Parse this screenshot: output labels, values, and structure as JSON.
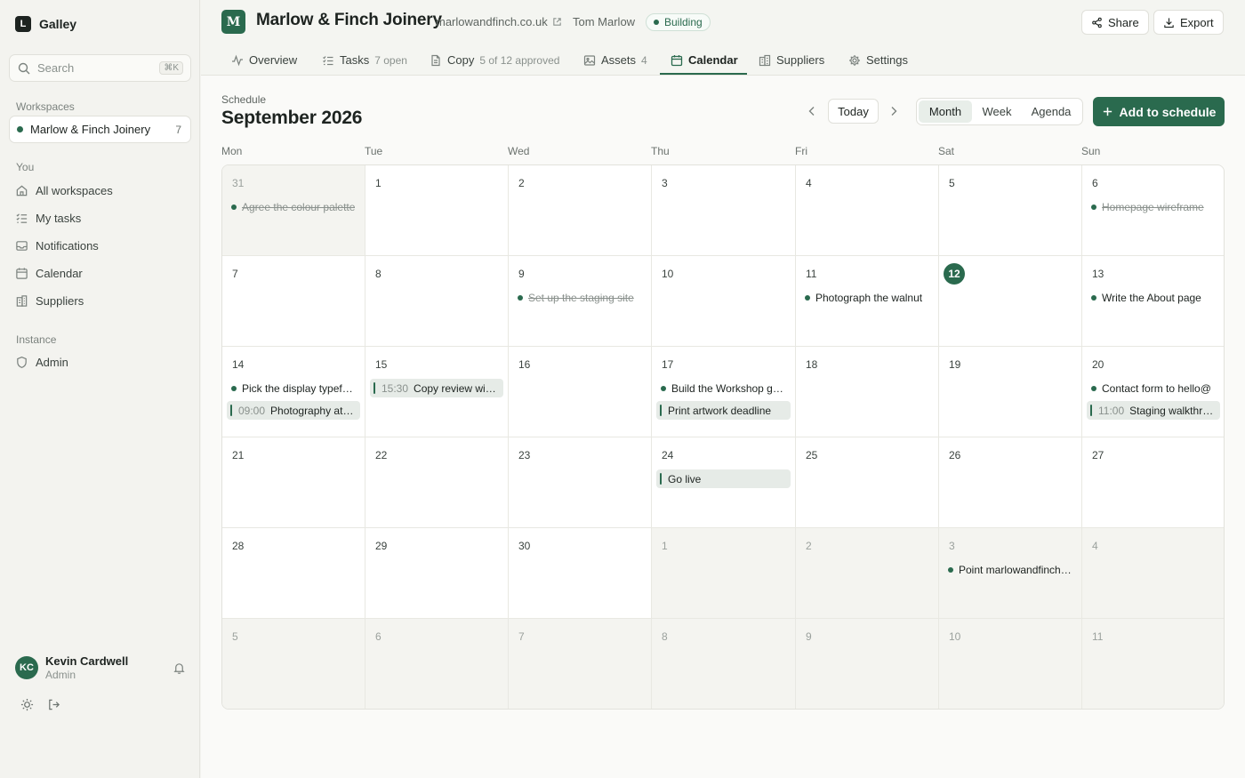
{
  "app": {
    "name": "Galley",
    "logo_letter": "L"
  },
  "sidebar": {
    "search_placeholder": "Search",
    "search_shortcut": "⌘K",
    "workspaces_label": "Workspaces",
    "workspace": {
      "name": "Marlow & Finch Joinery",
      "count": "7"
    },
    "you_label": "You",
    "you_items": [
      "All workspaces",
      "My tasks",
      "Notifications",
      "Calendar",
      "Suppliers"
    ],
    "instance_label": "Instance",
    "instance_items": [
      "Admin"
    ],
    "user": {
      "initials": "KC",
      "name": "Kevin Cardwell",
      "role": "Admin"
    }
  },
  "header": {
    "logo_letter": "M",
    "title": "Marlow & Finch Joinery",
    "url": "marlowandfinch.co.uk",
    "owner": "Tom Marlow",
    "status": "Building",
    "share_label": "Share",
    "export_label": "Export",
    "tabs": [
      {
        "label": "Overview",
        "meta": ""
      },
      {
        "label": "Tasks",
        "meta": "7 open"
      },
      {
        "label": "Copy",
        "meta": "5 of 12 approved"
      },
      {
        "label": "Assets",
        "meta": "4"
      },
      {
        "label": "Calendar",
        "meta": ""
      },
      {
        "label": "Suppliers",
        "meta": ""
      },
      {
        "label": "Settings",
        "meta": ""
      }
    ],
    "active_tab": "Calendar"
  },
  "toolbar": {
    "breadcrumb": "Schedule",
    "title": "September 2026",
    "today_label": "Today",
    "views": [
      "Month",
      "Week",
      "Agenda"
    ],
    "active_view": "Month",
    "add_label": "Add to schedule"
  },
  "colors": {
    "accent": "#2a6a4e",
    "accent_soft": "#e6ebe7",
    "out_of_month": "#f4f4f0"
  },
  "calendar": {
    "weekdays": [
      "Mon",
      "Tue",
      "Wed",
      "Thu",
      "Fri",
      "Sat",
      "Sun"
    ],
    "today": "12",
    "weeks": [
      [
        {
          "day": "31",
          "out": true,
          "events": [
            {
              "kind": "task",
              "done": true,
              "text": "Agree the colour palette"
            }
          ]
        },
        {
          "day": "1",
          "events": []
        },
        {
          "day": "2",
          "events": []
        },
        {
          "day": "3",
          "events": []
        },
        {
          "day": "4",
          "events": []
        },
        {
          "day": "5",
          "events": []
        },
        {
          "day": "6",
          "events": [
            {
              "kind": "task",
              "done": true,
              "text": "Homepage wireframe"
            }
          ]
        }
      ],
      [
        {
          "day": "7",
          "events": []
        },
        {
          "day": "8",
          "events": []
        },
        {
          "day": "9",
          "events": [
            {
              "kind": "task",
              "done": true,
              "text": "Set up the staging site"
            }
          ]
        },
        {
          "day": "10",
          "events": []
        },
        {
          "day": "11",
          "events": [
            {
              "kind": "task",
              "done": false,
              "text": "Photograph the walnut"
            }
          ]
        },
        {
          "day": "12",
          "today": true,
          "events": []
        },
        {
          "day": "13",
          "events": [
            {
              "kind": "task",
              "done": false,
              "text": "Write the About page"
            }
          ]
        }
      ],
      [
        {
          "day": "14",
          "events": [
            {
              "kind": "task",
              "done": false,
              "text": "Pick the display typeface"
            },
            {
              "kind": "event",
              "time": "09:00",
              "text": "Photography at the workshop"
            }
          ]
        },
        {
          "day": "15",
          "events": [
            {
              "kind": "event",
              "time": "15:30",
              "text": "Copy review with Tom"
            }
          ]
        },
        {
          "day": "16",
          "events": []
        },
        {
          "day": "17",
          "events": [
            {
              "kind": "task",
              "done": false,
              "text": "Build the Workshop gallery"
            },
            {
              "kind": "event",
              "time": "",
              "text": "Print artwork deadline"
            }
          ]
        },
        {
          "day": "18",
          "events": []
        },
        {
          "day": "19",
          "events": []
        },
        {
          "day": "20",
          "events": [
            {
              "kind": "task",
              "done": false,
              "text": "Contact form to hello@"
            },
            {
              "kind": "event",
              "time": "11:00",
              "text": "Staging walkthrough"
            }
          ]
        }
      ],
      [
        {
          "day": "21",
          "events": []
        },
        {
          "day": "22",
          "events": []
        },
        {
          "day": "23",
          "events": []
        },
        {
          "day": "24",
          "events": [
            {
              "kind": "event",
              "time": "",
              "text": "Go live"
            }
          ]
        },
        {
          "day": "25",
          "events": []
        },
        {
          "day": "26",
          "events": []
        },
        {
          "day": "27",
          "events": []
        }
      ],
      [
        {
          "day": "28",
          "events": []
        },
        {
          "day": "29",
          "events": []
        },
        {
          "day": "30",
          "events": []
        },
        {
          "day": "1",
          "out": true,
          "events": []
        },
        {
          "day": "2",
          "out": true,
          "events": []
        },
        {
          "day": "3",
          "out": true,
          "events": [
            {
              "kind": "task",
              "done": false,
              "text": "Point marlowandfinch.co.uk"
            }
          ]
        },
        {
          "day": "4",
          "out": true,
          "events": []
        }
      ],
      [
        {
          "day": "5",
          "out": true,
          "events": []
        },
        {
          "day": "6",
          "out": true,
          "events": []
        },
        {
          "day": "7",
          "out": true,
          "events": []
        },
        {
          "day": "8",
          "out": true,
          "events": []
        },
        {
          "day": "9",
          "out": true,
          "events": []
        },
        {
          "day": "10",
          "out": true,
          "events": []
        },
        {
          "day": "11",
          "out": true,
          "events": []
        }
      ]
    ]
  }
}
